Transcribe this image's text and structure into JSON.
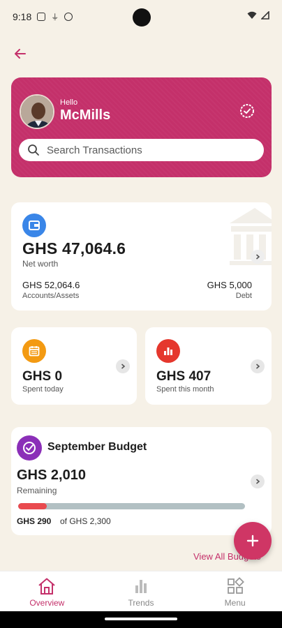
{
  "status_bar": {
    "time": "9:18",
    "icons": [
      "shield-icon",
      "mic-icon",
      "face-icon",
      "wifi-icon",
      "signal-icon"
    ]
  },
  "header": {
    "back_icon": "arrow-left-icon",
    "greeting": "Hello",
    "user_name": "McMills",
    "verify_icon": "check-circle-icon"
  },
  "search": {
    "placeholder": "Search Transactions",
    "icon": "search-icon"
  },
  "net_worth": {
    "icon": "wallet-icon",
    "amount": "GHS 47,064.6",
    "label": "Net worth",
    "accounts_amount": "GHS 52,064.6",
    "accounts_label": "Accounts/Assets",
    "debt_amount": "GHS 5,000",
    "debt_label": "Debt"
  },
  "spent_today": {
    "icon": "calendar-icon",
    "amount": "GHS 0",
    "label": "Spent today"
  },
  "spent_month": {
    "icon": "bar-chart-icon",
    "amount": "GHS 407",
    "label": "Spent this month"
  },
  "budget": {
    "icon": "check-circle-icon",
    "title": "September Budget",
    "remaining_amount": "GHS 2,010",
    "remaining_label": "Remaining",
    "spent": "GHS 290",
    "of_total": "of GHS 2,300",
    "progress_fraction": 0.126,
    "view_all_label": "View All Budgets"
  },
  "fab": {
    "icon": "plus-icon"
  },
  "bottom_nav": [
    {
      "label": "Overview",
      "icon": "home-icon",
      "active": true
    },
    {
      "label": "Trends",
      "icon": "bar-chart-icon",
      "active": false
    },
    {
      "label": "Menu",
      "icon": "grid-menu-icon",
      "active": false
    }
  ],
  "colors": {
    "background": "#f6f1e7",
    "brand": "#c4306a",
    "wallet_blue": "#3a86e8",
    "calendar_orange": "#f39a12",
    "chart_red": "#e5372d",
    "budget_purple": "#8b2fb8",
    "progress_red": "#e94a4f",
    "progress_track": "#b2c0c3"
  }
}
